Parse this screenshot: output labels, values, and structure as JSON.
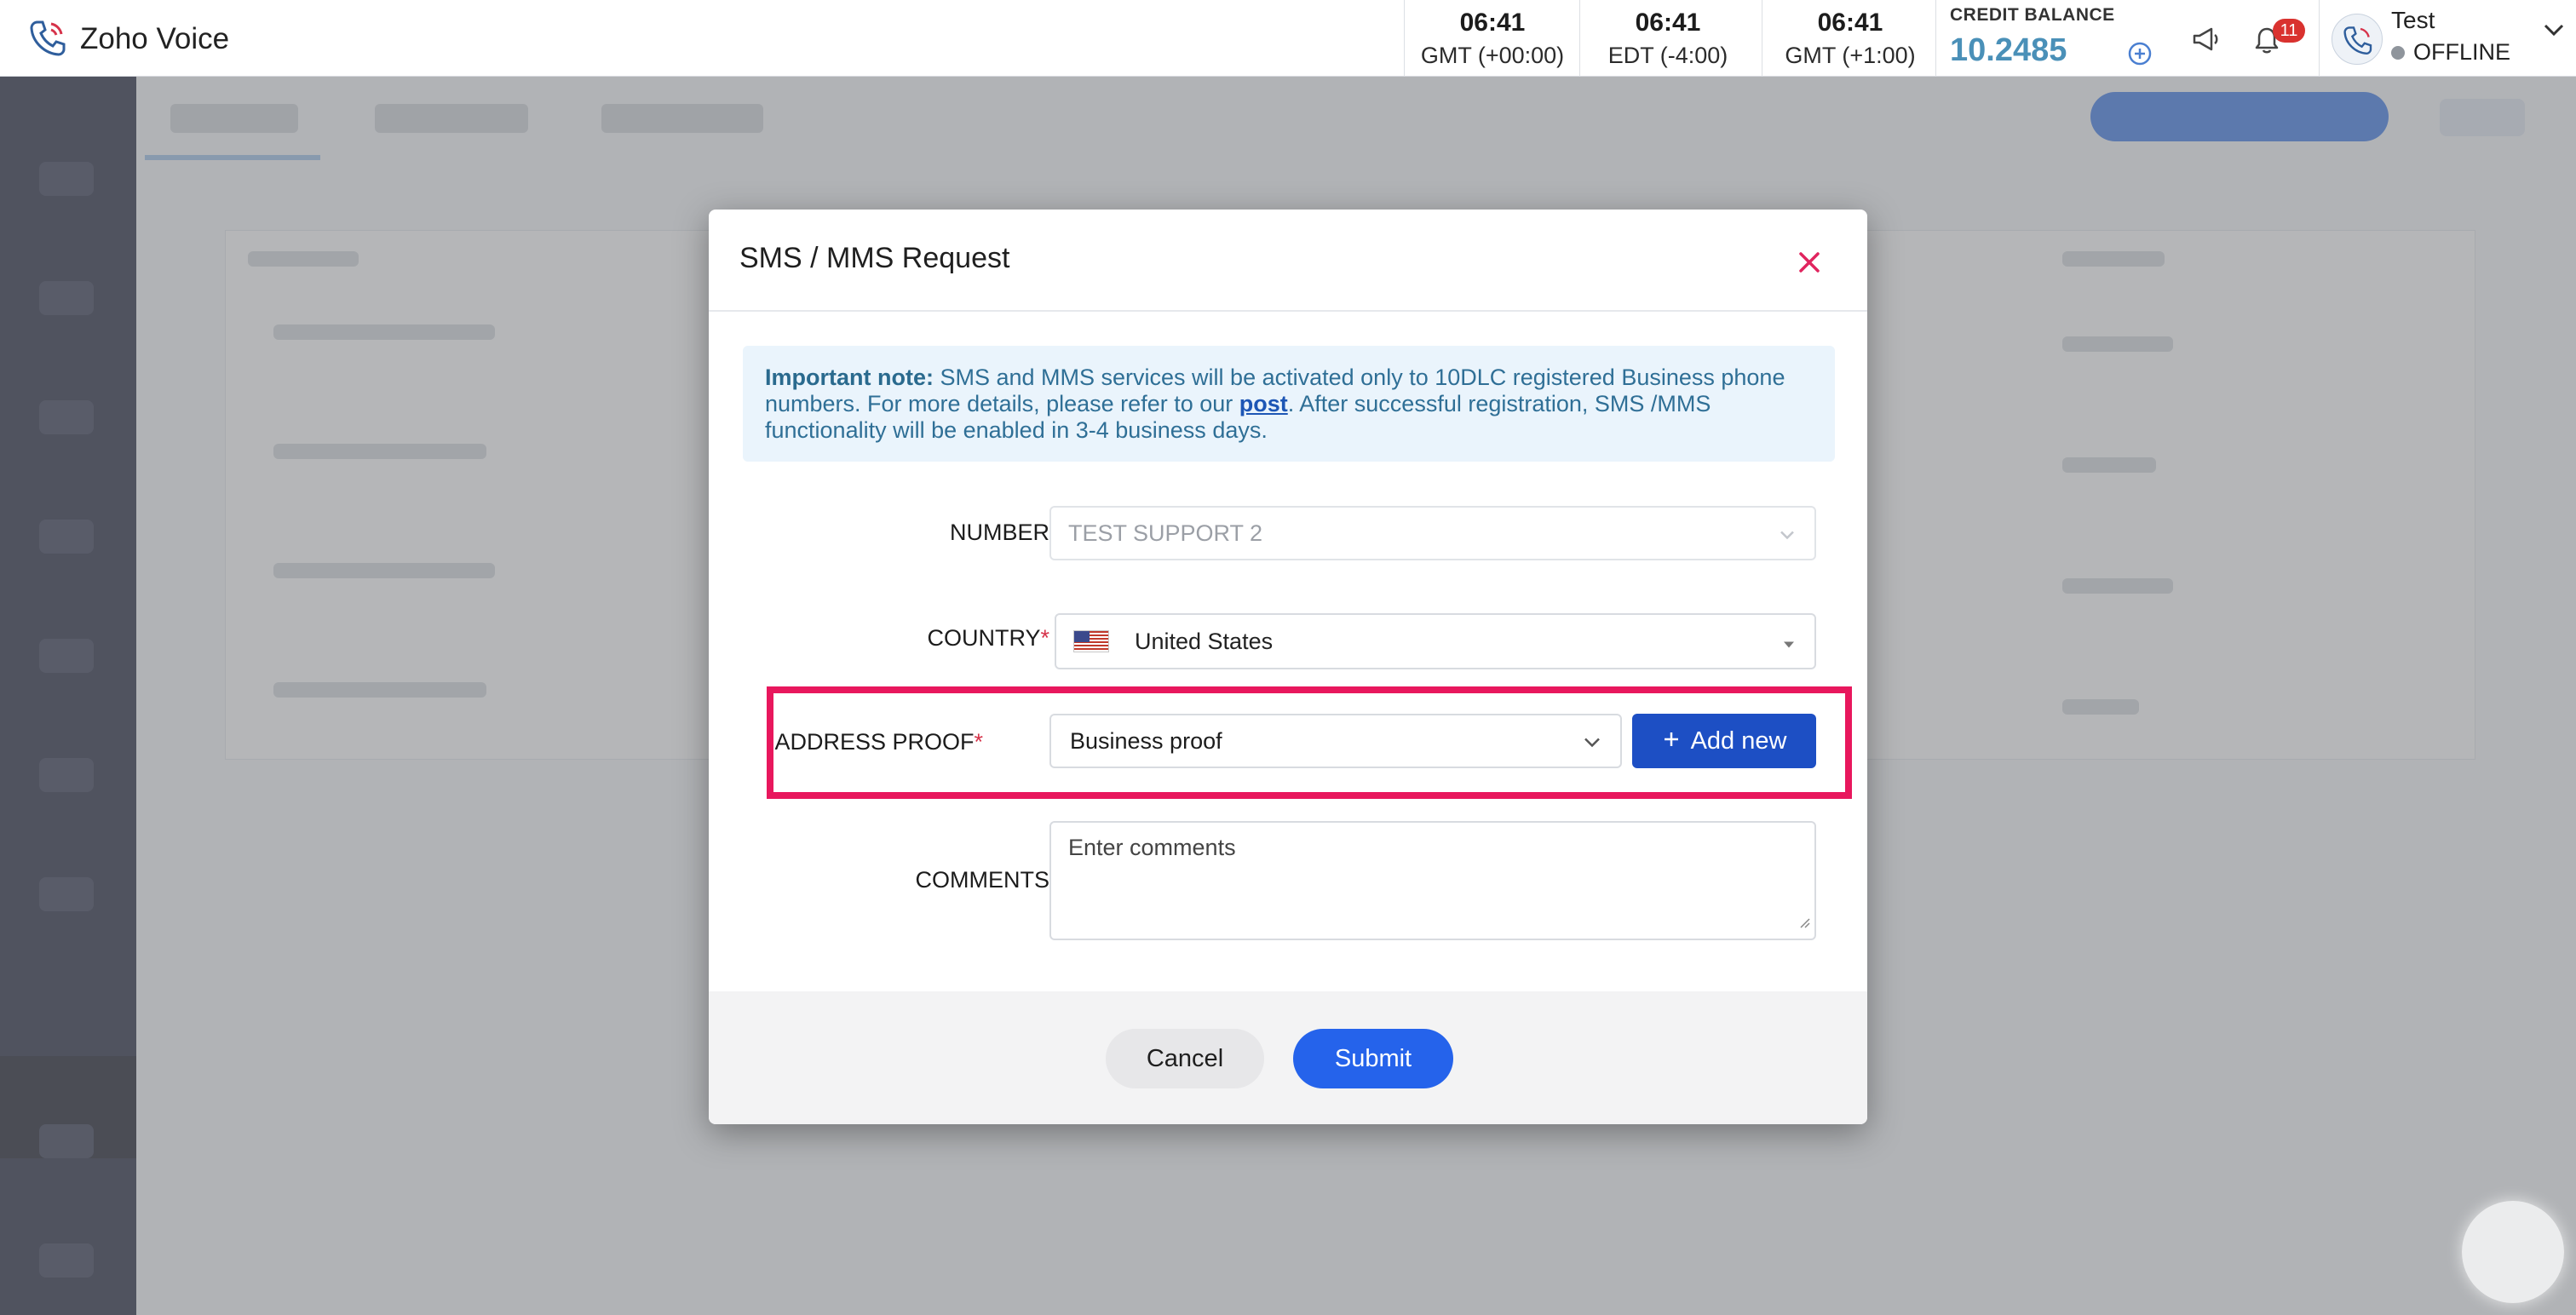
{
  "app": {
    "title": "Zoho Voice"
  },
  "clocks": [
    {
      "time": "06:41",
      "zone": "GMT (+00:00)"
    },
    {
      "time": "06:41",
      "zone": "EDT (-4:00)"
    },
    {
      "time": "06:41",
      "zone": "GMT (+1:00)"
    }
  ],
  "credit": {
    "label": "CREDIT BALANCE",
    "value": "10.2485"
  },
  "notifications": {
    "count": "11"
  },
  "user": {
    "name": "Test",
    "status": "OFFLINE"
  },
  "colors": {
    "accent": "#2563eb",
    "highlight": "#e8175d",
    "credit": "#4a90b8",
    "danger": "#d9322f"
  },
  "modal": {
    "title": "SMS / MMS Request",
    "note": {
      "heading": "Important note:",
      "text1": " SMS and MMS services will be activated only to 10DLC registered Business phone numbers. For more details, please refer to our ",
      "link": "post",
      "text2": ". After successful registration, SMS /MMS functionality will be enabled in 3-4 business days."
    },
    "number": {
      "label": "NUMBER",
      "value": "TEST SUPPORT 2"
    },
    "country": {
      "label": "COUNTRY",
      "value": "United States"
    },
    "address_proof": {
      "label": "ADDRESS PROOF",
      "value": "Business proof",
      "add_label": "Add new"
    },
    "comments": {
      "label": "COMMENTS",
      "placeholder": "Enter comments"
    },
    "required_mark": "*",
    "cancel_label": "Cancel",
    "submit_label": "Submit"
  }
}
